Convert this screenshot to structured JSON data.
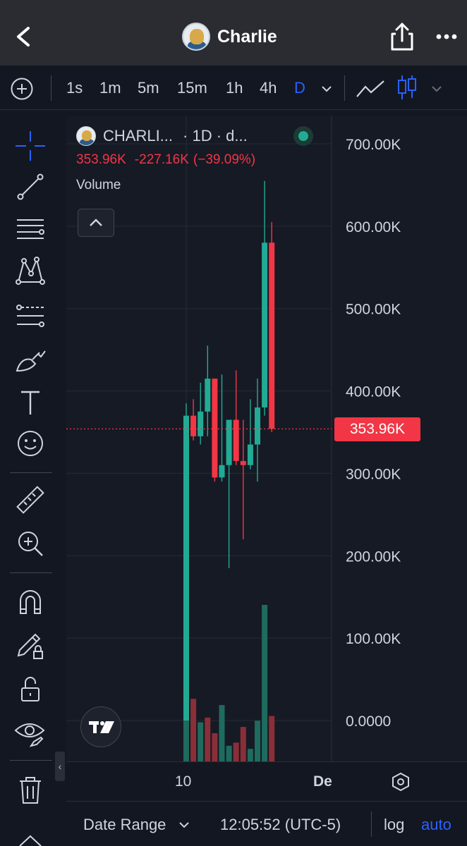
{
  "header": {
    "title": "Charlie"
  },
  "toolbar": {
    "intervals": [
      "1s",
      "1m",
      "5m",
      "15m",
      "1h",
      "4h",
      "D"
    ],
    "active_interval": "D"
  },
  "legend": {
    "symbol": "CHARLI...",
    "interval": "· 1D · d...",
    "close": "353.96K",
    "change": "-227.16K",
    "change_pct": "(−39.09%)",
    "volume_label": "Volume"
  },
  "price_tag": "353.96K",
  "x_axis": {
    "labels": [
      "10",
      "De"
    ]
  },
  "footer": {
    "date_range": "Date Range",
    "time": "12:05:52 (UTC-5)",
    "log": "log",
    "auto": "auto"
  },
  "colors": {
    "up": "#22ab94",
    "down": "#f23645",
    "accent": "#2962ff",
    "background": "#161a25"
  },
  "chart_data": {
    "type": "candlestick",
    "y_ticks": [
      "700.00K",
      "600.00K",
      "500.00K",
      "400.00K",
      "300.00K",
      "200.00K",
      "100.00K",
      "0.0000"
    ],
    "ylim": [
      0,
      700000
    ],
    "last_price": 353960,
    "candles": [
      {
        "open": 0,
        "high": 385000,
        "low": 0,
        "close": 370000
      },
      {
        "open": 370000,
        "high": 390000,
        "low": 340000,
        "close": 345000
      },
      {
        "open": 345000,
        "high": 410000,
        "low": 335000,
        "close": 375000
      },
      {
        "open": 375000,
        "high": 455000,
        "low": 345000,
        "close": 415000
      },
      {
        "open": 415000,
        "high": 415000,
        "low": 290000,
        "close": 295000
      },
      {
        "open": 295000,
        "high": 420000,
        "low": 290000,
        "close": 310000
      },
      {
        "open": 310000,
        "high": 360000,
        "low": 185000,
        "close": 365000
      },
      {
        "open": 365000,
        "high": 425000,
        "low": 310000,
        "close": 315000
      },
      {
        "open": 315000,
        "high": 365000,
        "low": 220000,
        "close": 310000
      },
      {
        "open": 310000,
        "high": 390000,
        "low": 305000,
        "close": 335000
      },
      {
        "open": 335000,
        "high": 415000,
        "low": 290000,
        "close": 380000
      },
      {
        "open": 380000,
        "high": 655000,
        "low": 370000,
        "close": 580000
      },
      {
        "open": 580000,
        "high": 605000,
        "low": 350000,
        "close": 354000
      }
    ],
    "volume_bars": [
      {
        "value": 0.66,
        "dir": "up"
      },
      {
        "value": 0.4,
        "dir": "down"
      },
      {
        "value": 0.25,
        "dir": "up"
      },
      {
        "value": 0.28,
        "dir": "down"
      },
      {
        "value": 0.18,
        "dir": "down"
      },
      {
        "value": 0.36,
        "dir": "up"
      },
      {
        "value": 0.1,
        "dir": "up"
      },
      {
        "value": 0.12,
        "dir": "down"
      },
      {
        "value": 0.22,
        "dir": "down"
      },
      {
        "value": 0.08,
        "dir": "up"
      },
      {
        "value": 0.26,
        "dir": "up"
      },
      {
        "value": 1.0,
        "dir": "up"
      },
      {
        "value": 0.29,
        "dir": "down"
      }
    ]
  }
}
